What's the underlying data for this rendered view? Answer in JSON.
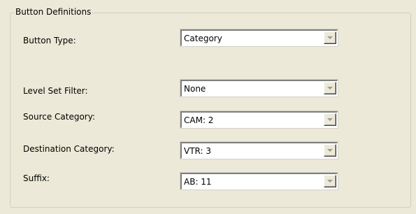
{
  "group": {
    "title": "Button Definitions"
  },
  "fields": {
    "button_type": {
      "label": "Button Type:",
      "value": "Category"
    },
    "level_set_filter": {
      "label": "Level Set Filter:",
      "value": "None"
    },
    "source_category": {
      "label": "Source Category:",
      "value": "CAM: 2"
    },
    "destination_category": {
      "label": "Destination Category:",
      "value": "VTR: 3"
    },
    "suffix": {
      "label": "Suffix:",
      "value": "AB: 11"
    }
  },
  "icons": {
    "dropdown": "chevron-down-icon"
  }
}
